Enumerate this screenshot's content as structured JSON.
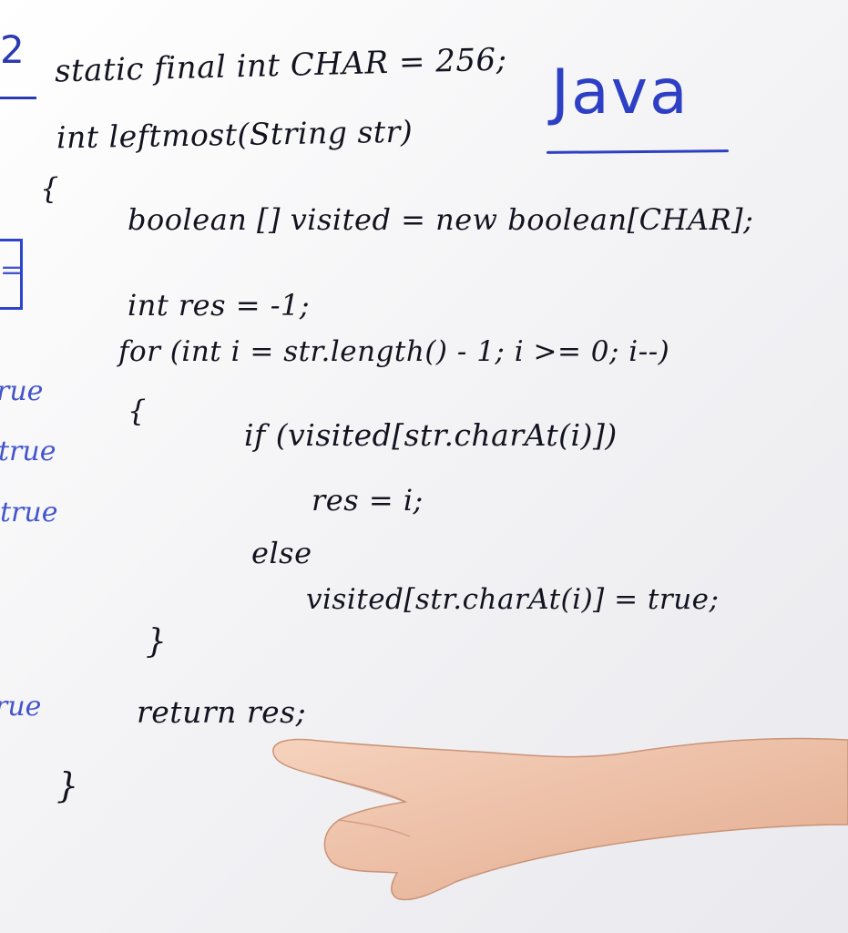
{
  "board": {
    "title": "Java",
    "left_mark": "2",
    "left_margin": {
      "box_symbol": "=",
      "true_words": [
        "rue",
        "true",
        "true",
        "rue"
      ]
    },
    "code_lines": [
      "static final int CHAR = 256;",
      "int leftmost(String str)",
      "{",
      "boolean [] visited = new boolean[CHAR];",
      "int res = -1;",
      "for (int i = str.length() - 1; i >= 0; i--)",
      "{",
      "if (visited[str.charAt(i)])",
      "res = i;",
      "else",
      "visited[str.charAt(i)] = true;",
      "}",
      "return res;",
      "}"
    ]
  },
  "colors": {
    "board": "#f2f2f5",
    "ink_black": "#141420",
    "ink_blue": "#2d3fc4",
    "skin": "#f0c7ad"
  }
}
